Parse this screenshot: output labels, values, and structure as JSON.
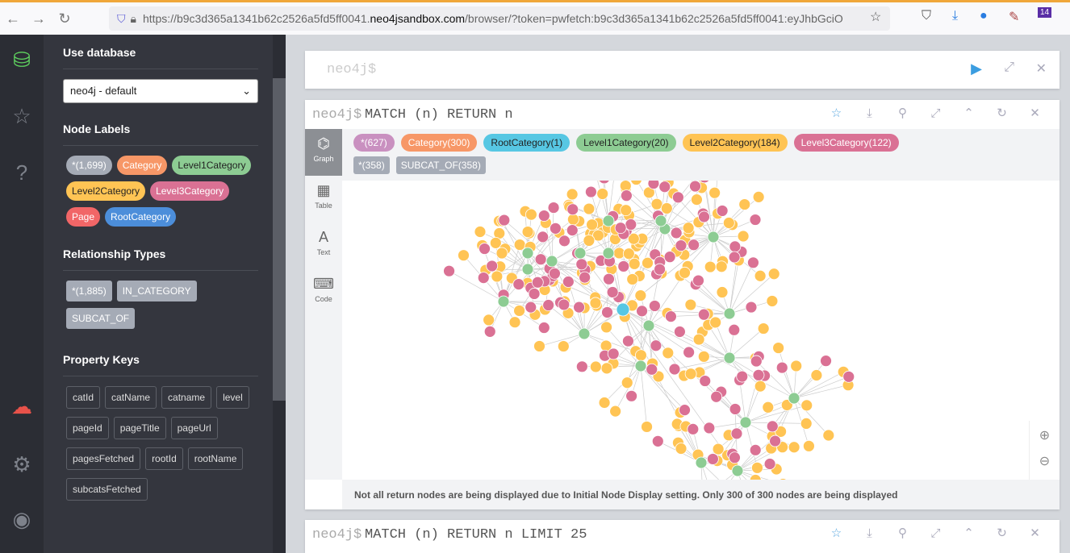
{
  "browser": {
    "url_prefix": "https://b9c3d365a1341b62c2526a5fd5ff0041.",
    "url_host": "neo4jsandbox.com",
    "url_suffix": "/browser/?token=pwfetch:b9c3d365a1341b62c2526a5fd5ff0041:eyJhbGciO",
    "badge": "14"
  },
  "sidebar": {
    "use_database": "Use database",
    "database": "neo4j - default",
    "node_labels_title": "Node Labels",
    "node_labels": [
      {
        "label": "*(1,699)",
        "color": "#a5abb6"
      },
      {
        "label": "Category",
        "color": "#f79767"
      },
      {
        "label": "Level1Category",
        "color": "#8dcc93"
      },
      {
        "label": "Level2Category",
        "color": "#ffc454"
      },
      {
        "label": "Level3Category",
        "color": "#da7194"
      },
      {
        "label": "Page",
        "color": "#f16667"
      },
      {
        "label": "RootCategory",
        "color": "#4c8eda"
      }
    ],
    "rel_title": "Relationship Types",
    "rel_types": [
      "*(1,885)",
      "IN_CATEGORY",
      "SUBCAT_OF"
    ],
    "prop_title": "Property Keys",
    "prop_keys": [
      "catId",
      "catName",
      "catname",
      "level",
      "pageId",
      "pageTitle",
      "pageUrl",
      "pagesFetched",
      "rootId",
      "rootName",
      "subcatsFetched"
    ]
  },
  "editor": {
    "prompt": "neo4j$"
  },
  "result": {
    "prompt": "neo4j$",
    "query": "MATCH (n) RETURN n",
    "tabs": [
      "Graph",
      "Table",
      "Text",
      "Code"
    ],
    "legend_nodes": [
      {
        "label": "*(627)",
        "color": "#c990c0",
        "dark": false
      },
      {
        "label": "Category(300)",
        "color": "#f79767",
        "dark": false
      },
      {
        "label": "RootCategory(1)",
        "color": "#57c7e3",
        "dark": true
      },
      {
        "label": "Level1Category(20)",
        "color": "#8dcc93",
        "dark": true
      },
      {
        "label": "Level2Category(184)",
        "color": "#ffc454",
        "dark": true
      },
      {
        "label": "Level3Category(122)",
        "color": "#da7194",
        "dark": false
      }
    ],
    "legend_rels": [
      "*(358)",
      "SUBCAT_OF(358)"
    ],
    "footer": "Not all return nodes are being displayed due to Initial Node Display setting. Only 300 of 300 nodes are being displayed",
    "graph_counts": {
      "level1": 20,
      "level2": 184,
      "level3": 122,
      "root": 1
    }
  },
  "next": {
    "prompt": "neo4j$",
    "query": "MATCH (n) RETURN n LIMIT 25"
  }
}
